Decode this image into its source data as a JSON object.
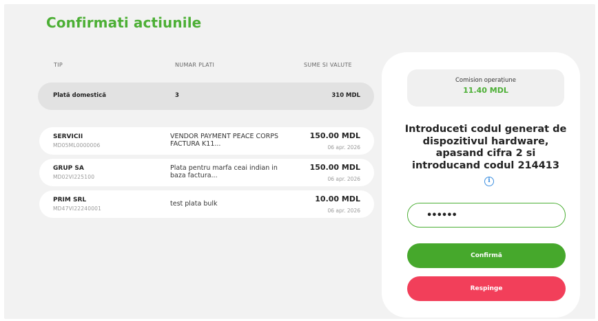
{
  "page": {
    "title": "Confirmati actiunile"
  },
  "table": {
    "headers": [
      "TIP",
      "NUMAR PLATI",
      "SUME SI VALUTE"
    ],
    "summary": {
      "type": "Plată domestică",
      "count": "3",
      "amount": "310 MDL"
    },
    "payments": [
      {
        "name": "SERVICII",
        "account": "MD05ML0000006",
        "description": "VENDOR PAYMENT PEACE CORPS FACTURA K11...",
        "amount": "150.00 MDL",
        "date": "06 apr. 2026"
      },
      {
        "name": "GRUP SA",
        "account": "MD02VI225100",
        "description": "Plata pentru marfa ceai indian in baza factura...",
        "amount": "150.00 MDL",
        "date": "06 apr. 2026"
      },
      {
        "name": "PRIM SRL",
        "account": "MD47VI22240001",
        "description": "test plata bulk",
        "amount": "10.00 MDL",
        "date": "06 apr. 2026"
      }
    ]
  },
  "panel": {
    "fee_label": "Comision operațiune",
    "fee_value": "11.40 MDL",
    "instruction": "Introduceti codul generat de dispozitivul hardware, apasand cifra 2 si introducand codul 214413",
    "info_icon": "info-icon",
    "code_value": "••••••",
    "confirm_label": "Confirmă",
    "reject_label": "Respinge"
  },
  "colors": {
    "accent_green": "#4caf35",
    "confirm": "#46a82c",
    "reject": "#f23f5a",
    "info": "#3d8fe0"
  }
}
